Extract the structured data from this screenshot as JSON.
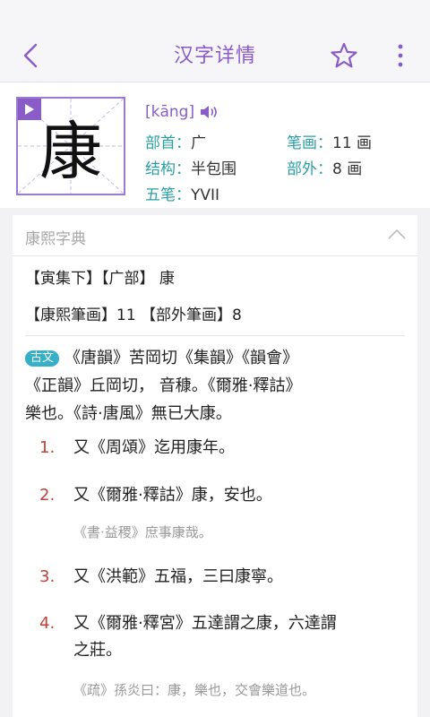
{
  "header": {
    "title": "汉字详情"
  },
  "char": {
    "glyph": "康",
    "pinyin": "[kāng]",
    "radical_label": "部首：",
    "radical_value": "广",
    "strokes_label": "笔画：",
    "strokes_value": "11 画",
    "structure_label": "结构：",
    "structure_value": "半包围",
    "outer_label": "部外：",
    "outer_value": "8 画",
    "wubi_label": "五笔：",
    "wubi_value": "YVII"
  },
  "dict": {
    "title": "康熙字典",
    "line1": "【寅集下】【广部】 康",
    "line2": "【康熙筆画】11 【部外筆画】8",
    "tag": "古文",
    "para1_a": "《唐韻》苦岡切《集韻》《韻會》",
    "para1_b": "《正韻》丘岡切， 音穅。《爾雅·釋詁》",
    "para1_c": "樂也。《詩·唐風》無已大康。",
    "items": [
      {
        "num": "1.",
        "text": "又《周頌》迄用康年。"
      },
      {
        "num": "2.",
        "text": "又《爾雅·釋詁》康，安也。",
        "quote": "《書·益稷》庶事康哉。"
      },
      {
        "num": "3.",
        "text": "又《洪範》五福，三曰康寧。"
      },
      {
        "num": "4.",
        "text_a": "又《爾雅·釋宮》五達謂之康，六達謂",
        "text_b": "之莊。",
        "quote": "《疏》孫炎曰：康，樂也，交會樂道也。"
      }
    ]
  },
  "colors": {
    "accent": "#8a5cc8",
    "label": "#2aa0a6",
    "number": "#c2403a",
    "tag": "#35b0c8"
  }
}
